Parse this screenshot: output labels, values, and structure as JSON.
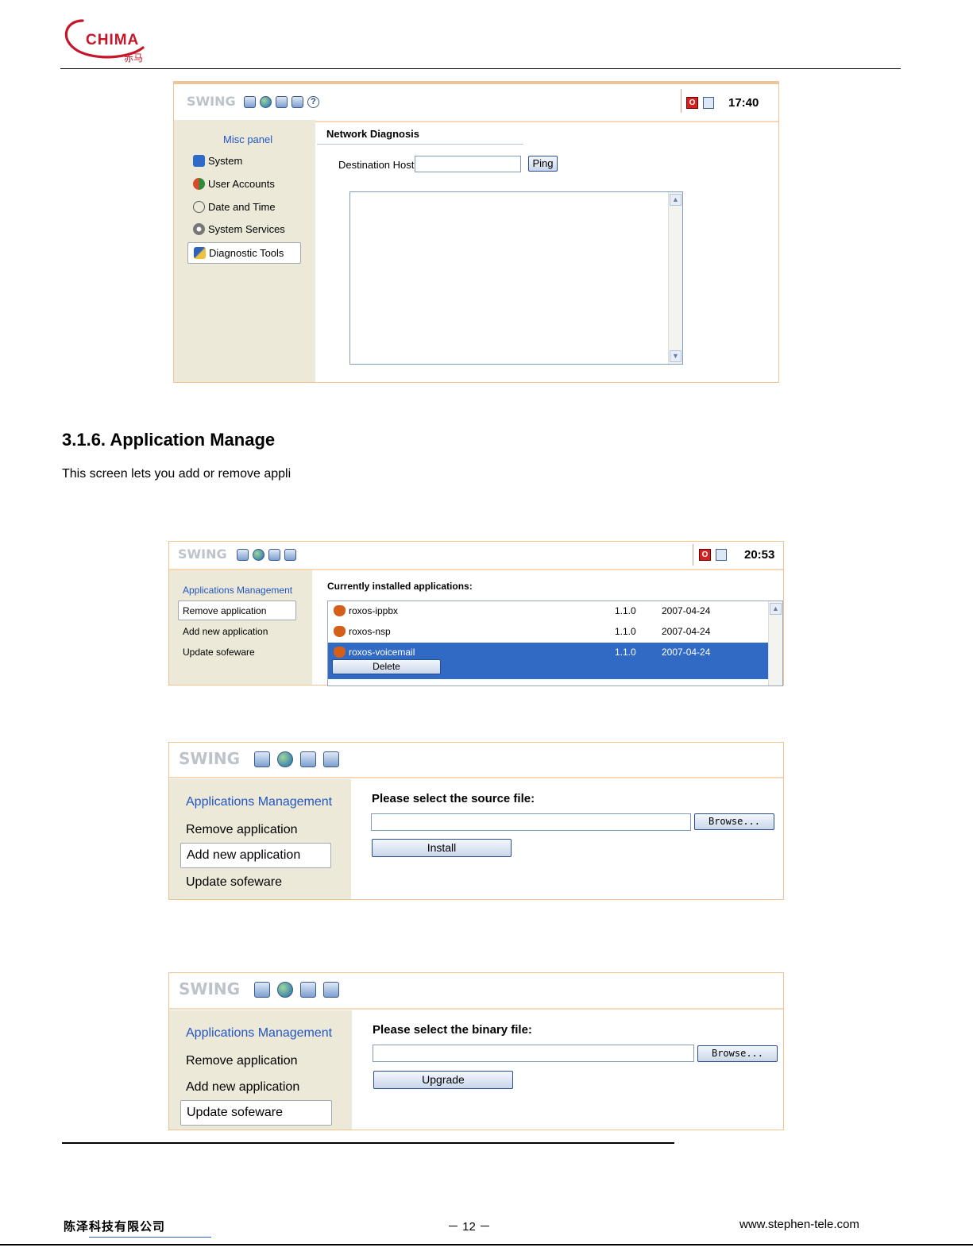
{
  "header": {
    "logo_text": "CHIMA",
    "logo_sub": "赤马"
  },
  "shot1": {
    "brand": "SWING",
    "clock": "17:40",
    "sidebar_title": "Misc panel",
    "sidebar_items": [
      "System",
      "User Accounts",
      "Date and Time",
      "System Services",
      "Diagnostic Tools"
    ],
    "content_title": "Network Diagnosis",
    "host_label": "Destination Host",
    "host_value": "",
    "ping_label": "Ping"
  },
  "section": {
    "heading": "3.1.6. Application Manage",
    "body": "This screen lets you add or remove appli"
  },
  "shot2": {
    "brand": "SWING",
    "clock": "20:53",
    "sidebar_title": "Applications Management",
    "sidebar_items": [
      "Remove application",
      "Add new application",
      "Update sofeware"
    ],
    "content_title": "Currently installed applications:",
    "apps": [
      {
        "name": "roxos-ippbx",
        "version": "1.1.0",
        "date": "2007-04-24"
      },
      {
        "name": "roxos-nsp",
        "version": "1.1.0",
        "date": "2007-04-24"
      },
      {
        "name": "roxos-voicemail",
        "version": "1.1.0",
        "date": "2007-04-24"
      }
    ],
    "delete_label": "Delete"
  },
  "shot3": {
    "brand": "SWING",
    "sidebar_title": "Applications Management",
    "sidebar_items": [
      "Remove application",
      "Add new application",
      "Update sofeware"
    ],
    "content_title": "Please select the source file:",
    "browse_label": "Browse...",
    "install_label": "Install"
  },
  "shot4": {
    "brand": "SWING",
    "sidebar_title": "Applications Management",
    "sidebar_items": [
      "Remove application",
      "Add new application",
      "Update sofeware"
    ],
    "content_title": "Please select the binary file:",
    "browse_label": "Browse...",
    "upgrade_label": "Upgrade"
  },
  "footer": {
    "company": "陈泽科技有限公司",
    "page": "－ 12 －",
    "website": "www.stephen-tele.com"
  },
  "colors": {
    "brand_red": "#c5162a",
    "frame_orange": "#f3c291",
    "sidebar_bg": "#ece9d8",
    "link_blue": "#2255c5",
    "selection_blue": "#316ac5"
  }
}
